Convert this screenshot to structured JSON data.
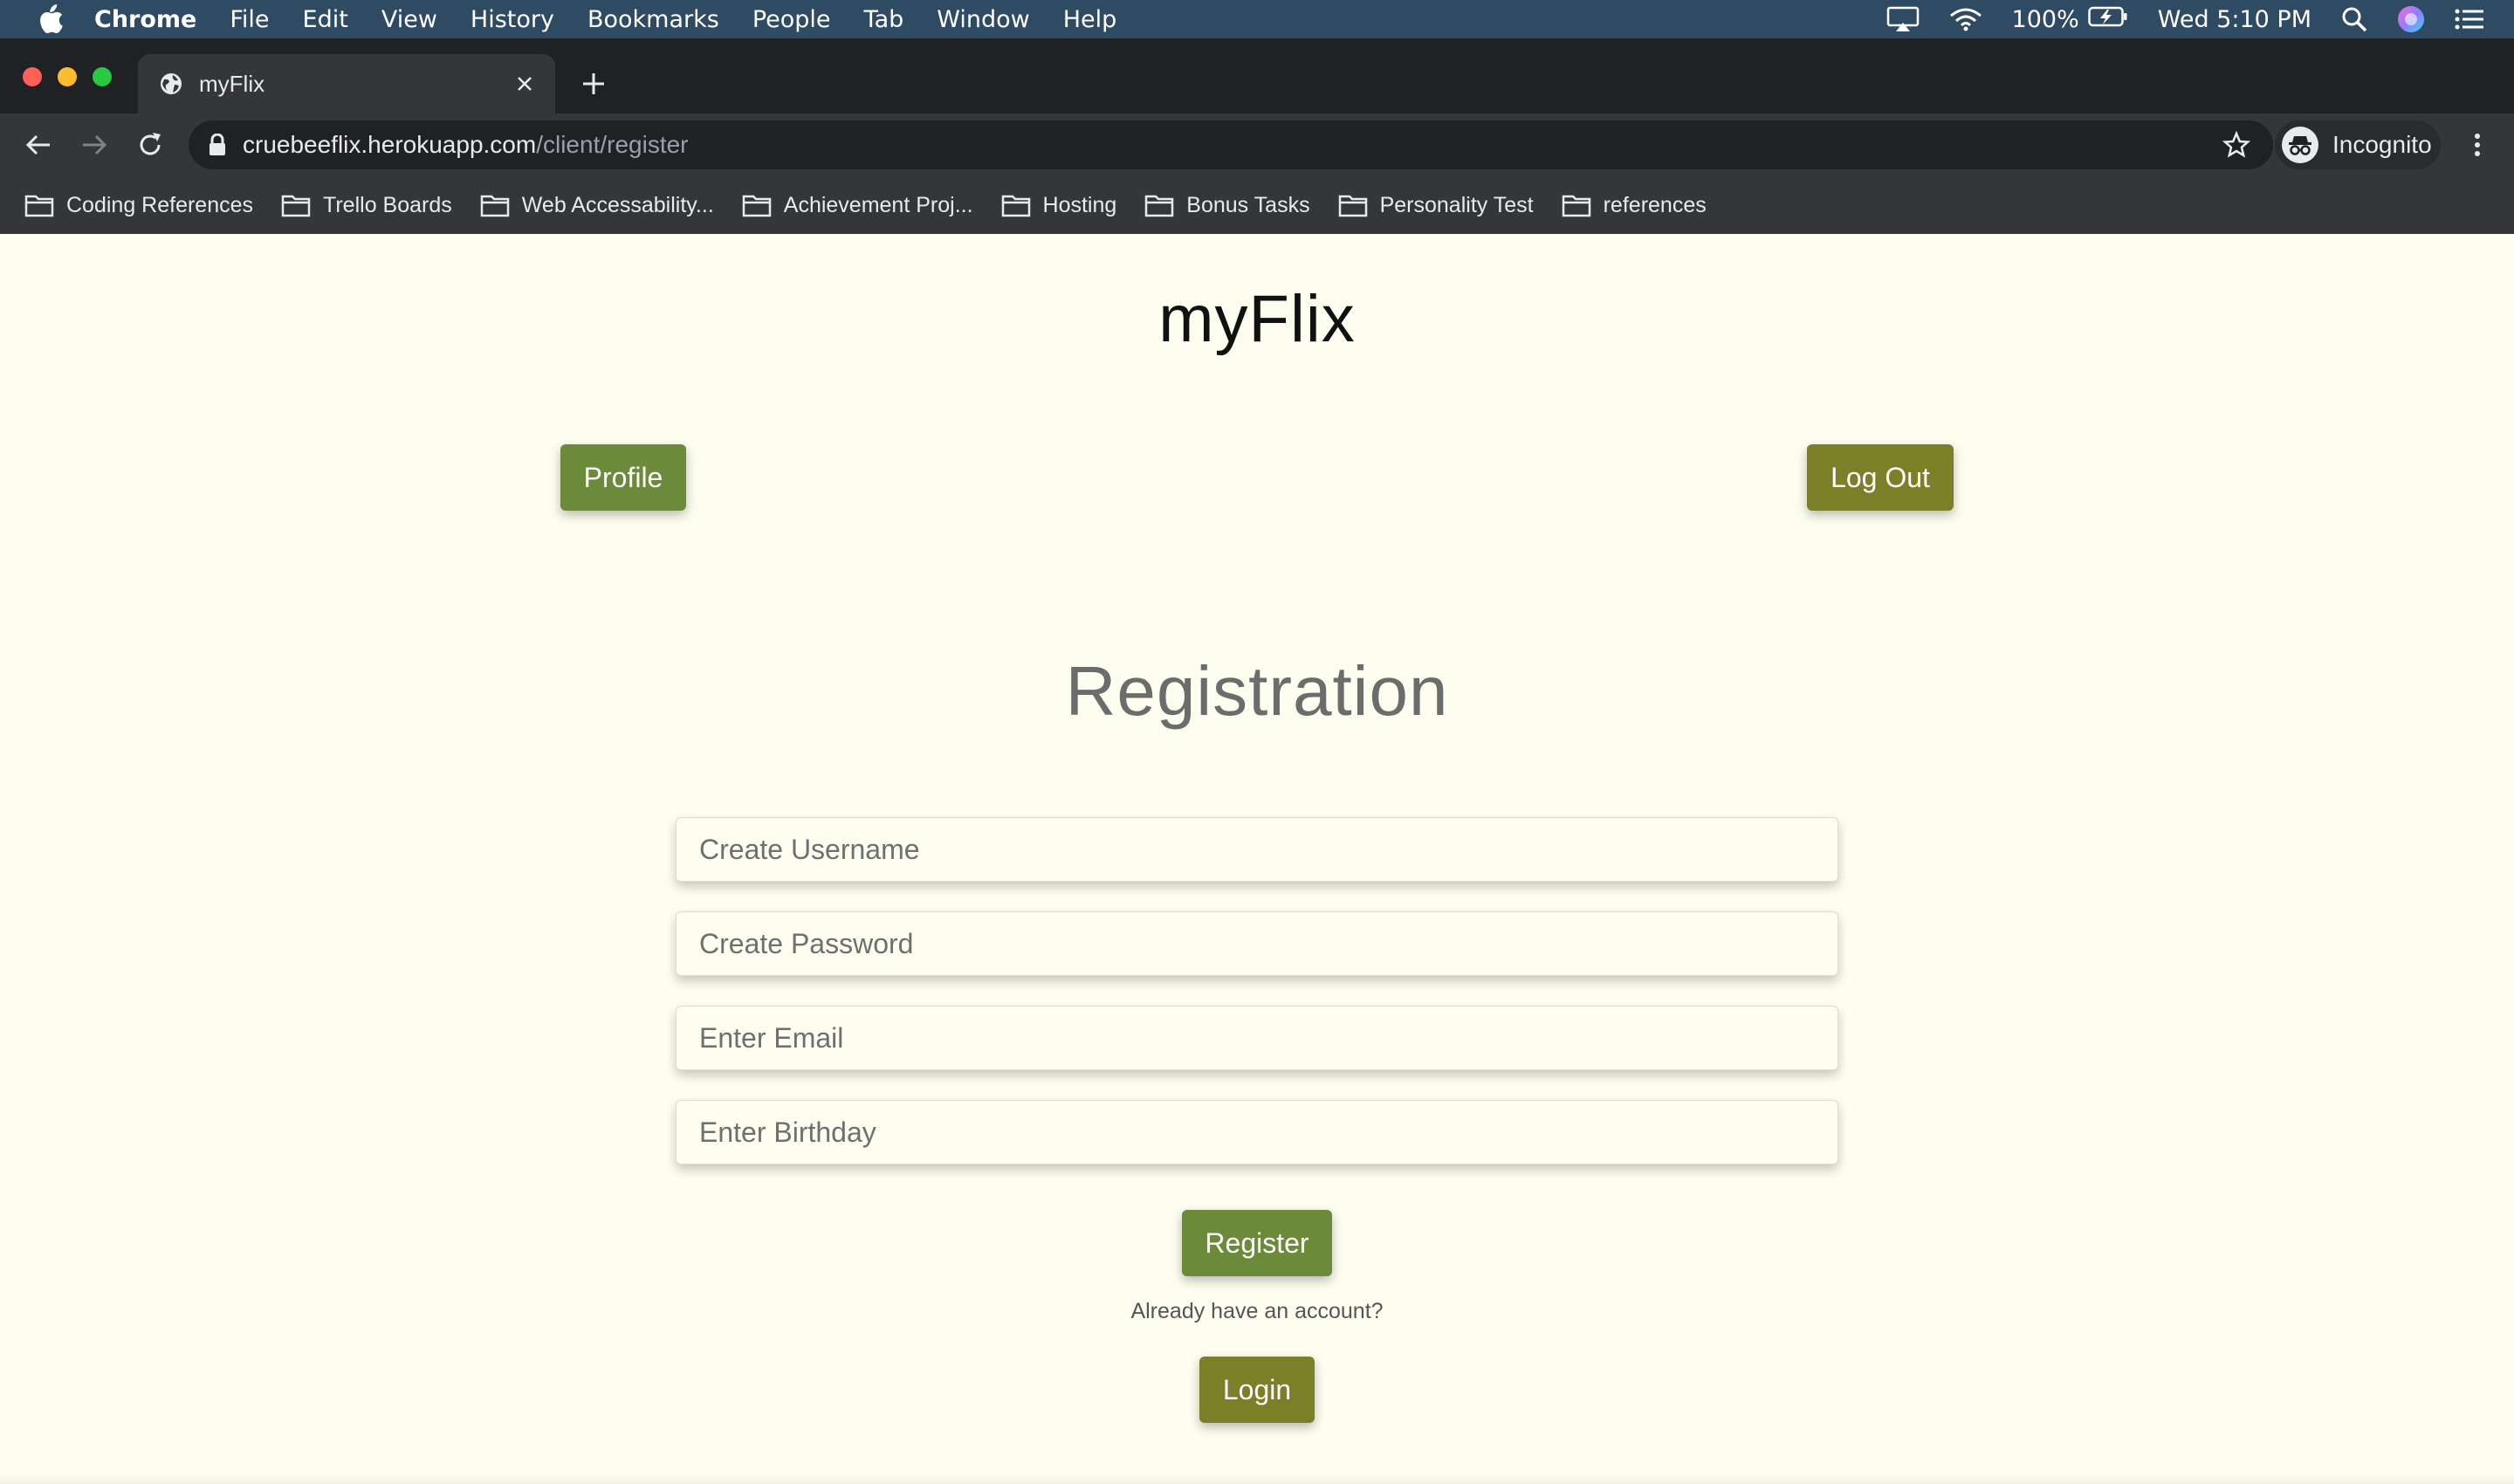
{
  "menubar": {
    "app": "Chrome",
    "items": [
      "File",
      "Edit",
      "View",
      "History",
      "Bookmarks",
      "People",
      "Tab",
      "Window",
      "Help"
    ],
    "battery": "100%",
    "clock": "Wed 5:10 PM"
  },
  "tab": {
    "title": "myFlix"
  },
  "omnibox": {
    "host": "cruebeeflix.herokuapp.com",
    "path": "/client/register"
  },
  "incognito": {
    "label": "Incognito"
  },
  "bookmarks": [
    "Coding References",
    "Trello Boards",
    "Web Accessability...",
    "Achievement Proj...",
    "Hosting",
    "Bonus Tasks",
    "Personality Test",
    "references"
  ],
  "page": {
    "brand": "myFlix",
    "profile_label": "Profile",
    "logout_label": "Log Out",
    "heading": "Registration",
    "fields": {
      "username_placeholder": "Create Username",
      "password_placeholder": "Create Password",
      "email_placeholder": "Enter Email",
      "birthday_placeholder": "Enter Birthday"
    },
    "register_label": "Register",
    "account_prompt": "Already have an account?",
    "login_label": "Login"
  },
  "colors": {
    "page_bg": "#fefef0",
    "button_green": "#6b8a3a",
    "button_olive": "#7a7f28",
    "menubar": "#2f4a63",
    "chrome_dark": "#202124"
  }
}
